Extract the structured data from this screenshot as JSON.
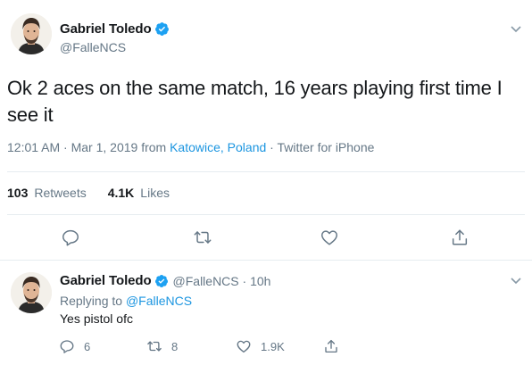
{
  "tweet": {
    "display_name": "Gabriel Toledo",
    "handle": "@FalleNCS",
    "text": "Ok 2 aces on the same match, 16 years playing first time I see it",
    "time": "12:01 AM · Mar 1, 2019 from ",
    "location": "Katowice, Poland",
    "source": " · Twitter for iPhone",
    "retweets_count": "103",
    "retweets_label": "Retweets",
    "likes_count": "4.1K",
    "likes_label": "Likes",
    "icons": {
      "verified": "verified-badge-icon",
      "menu": "chevron-down-icon",
      "reply": "reply-icon",
      "retweet": "retweet-icon",
      "like": "heart-icon",
      "share": "share-icon"
    }
  },
  "reply": {
    "display_name": "Gabriel Toledo",
    "handle_time": "@FalleNCS · 10h",
    "replying_prefix": "Replying to ",
    "replying_mention": "@FalleNCS",
    "text": "Yes pistol ofc",
    "reply_count": "6",
    "retweet_count": "8",
    "like_count": "1.9K"
  },
  "colors": {
    "accent": "#1b95e0",
    "verified": "#1da1f2",
    "secondary_text": "#657786",
    "primary_text": "#14171a",
    "divider": "#e6ecf0"
  }
}
